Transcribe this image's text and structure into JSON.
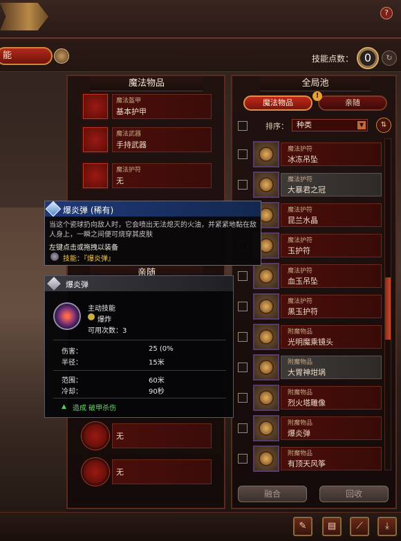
{
  "header": {
    "tab_label": "能",
    "skill_points_label": "技能点数：",
    "skill_points_value": "0",
    "help_label": "?"
  },
  "left_panel": {
    "title": "魔法物品",
    "slots": [
      {
        "category": "魔法盔甲",
        "name": "基本护甲"
      },
      {
        "category": "魔法武器",
        "name": "手持武器"
      },
      {
        "category": "魔法护符",
        "name": "无"
      }
    ],
    "companion_title": "亲随",
    "companion_slots": [
      {
        "name": "无"
      },
      {
        "name": "无"
      }
    ]
  },
  "right_panel": {
    "title": "全局池",
    "tabs": [
      "魔法物品",
      "亲随"
    ],
    "alert": "!",
    "sort_label": "排序：",
    "sort_value": "种类",
    "items": [
      {
        "category": "魔法护符",
        "name": "冰冻吊坠",
        "dim": false
      },
      {
        "category": "魔法护符",
        "name": "大暴君之冠",
        "dim": true
      },
      {
        "category": "魔法护符",
        "name": "昆兰水晶",
        "dim": false
      },
      {
        "category": "魔法护符",
        "name": "玉护符",
        "dim": false
      },
      {
        "category": "魔法护符",
        "name": "血玉吊坠",
        "dim": false
      },
      {
        "category": "魔法护符",
        "name": "黑玉护符",
        "dim": false
      },
      {
        "category": "附魔物品",
        "name": "光明魔乘镜头",
        "dim": false
      },
      {
        "category": "附魔物品",
        "name": "大胃神坩埚",
        "dim": true
      },
      {
        "category": "附魔物品",
        "name": "烈火塔雕像",
        "dim": false
      },
      {
        "category": "附魔物品",
        "name": "爆炎弹",
        "dim": false
      },
      {
        "category": "附魔物品",
        "name": "有顶天风筝",
        "dim": false
      }
    ],
    "fuse_label": "融合",
    "recycle_label": "回收"
  },
  "tooltip_main": {
    "title": "爆炎弹 (稀有)",
    "description": "当这个瓷球扔向敌人时，它会喷出无法熄灭的火油，并紧紧地黏在敌人身上，一瞬之间便可烧穿其皮肤",
    "hint": "左键点击或拖拽以装备",
    "skill": "技能：『爆炎弹』"
  },
  "tooltip_detail": {
    "title": "爆炎弹",
    "type": "主动技能",
    "combo": "爆炸",
    "uses": "可用次数：3",
    "stats": [
      {
        "label": "伤害：",
        "value": "25 (0%"
      },
      {
        "label": "半径：",
        "value": "15米"
      },
      {
        "label": "范围：",
        "value": "60米"
      },
      {
        "label": "冷却：",
        "value": "90秒"
      }
    ],
    "effect": "造成 破甲杀伤"
  },
  "colors": {
    "accent_red": "#b02a1a",
    "gold": "#d4b06a",
    "tooltip_blue": "#1e3a7a",
    "effect_green": "#6ad86a"
  }
}
